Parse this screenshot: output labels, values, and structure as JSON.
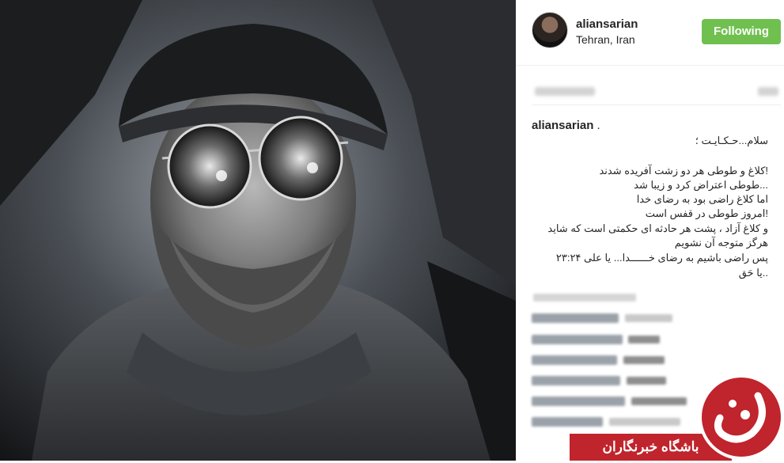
{
  "header": {
    "username": "aliansarian",
    "location": "Tehran, Iran",
    "follow_label": "Following"
  },
  "caption": {
    "username": "aliansarian",
    "lines": [
      "سلام...حـکـایـت ؛",
      "!کلاغ و طوطی هر دو زشت آفریده شدند",
      "...طوطی اعتراض کرد و زیبا شد",
      "اما کلاغ راضی بود به رضای خدا",
      "!امروز طوطی در قفس است",
      "و کلاغ آزاد ، پشت هر حادثه ای حکمتی است که شاید",
      "هرگز متوجه آن نشویم",
      "پس راضی باشیم به رضای خــــــدا... یا علی ۲۳:۲۴",
      "..یا حَق"
    ]
  },
  "watermark": {
    "banner_text": "باشگاه خبرنگاران",
    "brand_color": "#c0242c"
  },
  "colors": {
    "follow_green": "#70c050",
    "text": "#262626"
  }
}
